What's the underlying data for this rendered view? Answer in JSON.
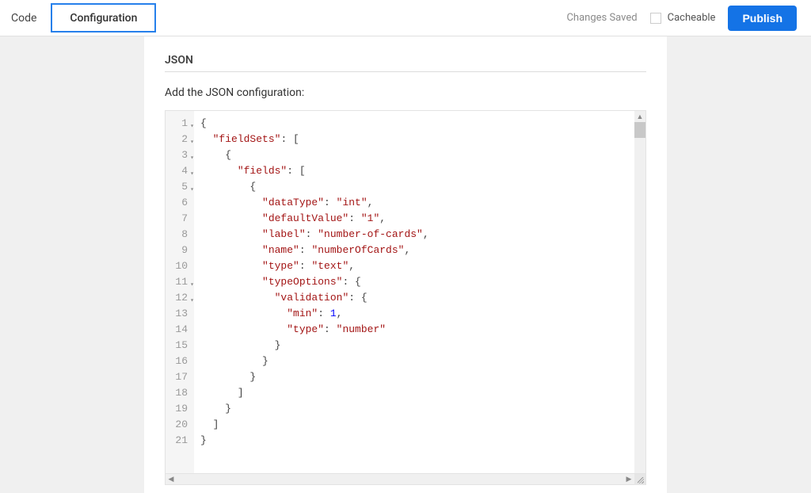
{
  "header": {
    "tabs": [
      {
        "id": "code",
        "label": "Code",
        "active": false
      },
      {
        "id": "configuration",
        "label": "Configuration",
        "active": true
      }
    ],
    "status": "Changes Saved",
    "cacheable_label": "Cacheable",
    "cacheable_checked": false,
    "publish_label": "Publish"
  },
  "panel": {
    "section_title": "JSON",
    "hint": "Add the JSON configuration:"
  },
  "editor": {
    "line_count": 21,
    "lines": [
      {
        "n": 1,
        "fold": true,
        "tokens": [
          [
            "p",
            "{"
          ]
        ]
      },
      {
        "n": 2,
        "fold": true,
        "tokens": [
          [
            "ws",
            "  "
          ],
          [
            "key",
            "\"fieldSets\""
          ],
          [
            "p",
            ": ["
          ]
        ]
      },
      {
        "n": 3,
        "fold": true,
        "tokens": [
          [
            "ws",
            "    "
          ],
          [
            "p",
            "{"
          ]
        ]
      },
      {
        "n": 4,
        "fold": true,
        "tokens": [
          [
            "ws",
            "      "
          ],
          [
            "key",
            "\"fields\""
          ],
          [
            "p",
            ": ["
          ]
        ]
      },
      {
        "n": 5,
        "fold": true,
        "tokens": [
          [
            "ws",
            "        "
          ],
          [
            "p",
            "{"
          ]
        ]
      },
      {
        "n": 6,
        "fold": false,
        "tokens": [
          [
            "ws",
            "          "
          ],
          [
            "key",
            "\"dataType\""
          ],
          [
            "p",
            ": "
          ],
          [
            "str",
            "\"int\""
          ],
          [
            "p",
            ","
          ]
        ]
      },
      {
        "n": 7,
        "fold": false,
        "tokens": [
          [
            "ws",
            "          "
          ],
          [
            "key",
            "\"defaultValue\""
          ],
          [
            "p",
            ": "
          ],
          [
            "str",
            "\"1\""
          ],
          [
            "p",
            ","
          ]
        ]
      },
      {
        "n": 8,
        "fold": false,
        "tokens": [
          [
            "ws",
            "          "
          ],
          [
            "key",
            "\"label\""
          ],
          [
            "p",
            ": "
          ],
          [
            "str",
            "\"number-of-cards\""
          ],
          [
            "p",
            ","
          ]
        ]
      },
      {
        "n": 9,
        "fold": false,
        "tokens": [
          [
            "ws",
            "          "
          ],
          [
            "key",
            "\"name\""
          ],
          [
            "p",
            ": "
          ],
          [
            "str",
            "\"numberOfCards\""
          ],
          [
            "p",
            ","
          ]
        ]
      },
      {
        "n": 10,
        "fold": false,
        "tokens": [
          [
            "ws",
            "          "
          ],
          [
            "key",
            "\"type\""
          ],
          [
            "p",
            ": "
          ],
          [
            "str",
            "\"text\""
          ],
          [
            "p",
            ","
          ]
        ]
      },
      {
        "n": 11,
        "fold": true,
        "tokens": [
          [
            "ws",
            "          "
          ],
          [
            "key",
            "\"typeOptions\""
          ],
          [
            "p",
            ": {"
          ]
        ]
      },
      {
        "n": 12,
        "fold": true,
        "tokens": [
          [
            "ws",
            "            "
          ],
          [
            "key",
            "\"validation\""
          ],
          [
            "p",
            ": {"
          ]
        ]
      },
      {
        "n": 13,
        "fold": false,
        "tokens": [
          [
            "ws",
            "              "
          ],
          [
            "key",
            "\"min\""
          ],
          [
            "p",
            ": "
          ],
          [
            "num",
            "1"
          ],
          [
            "p",
            ","
          ]
        ]
      },
      {
        "n": 14,
        "fold": false,
        "tokens": [
          [
            "ws",
            "              "
          ],
          [
            "key",
            "\"type\""
          ],
          [
            "p",
            ": "
          ],
          [
            "str",
            "\"number\""
          ]
        ]
      },
      {
        "n": 15,
        "fold": false,
        "tokens": [
          [
            "ws",
            "            "
          ],
          [
            "p",
            "}"
          ]
        ]
      },
      {
        "n": 16,
        "fold": false,
        "tokens": [
          [
            "ws",
            "          "
          ],
          [
            "p",
            "}"
          ]
        ]
      },
      {
        "n": 17,
        "fold": false,
        "tokens": [
          [
            "ws",
            "        "
          ],
          [
            "p",
            "}"
          ]
        ]
      },
      {
        "n": 18,
        "fold": false,
        "tokens": [
          [
            "ws",
            "      "
          ],
          [
            "p",
            "]"
          ]
        ]
      },
      {
        "n": 19,
        "fold": false,
        "tokens": [
          [
            "ws",
            "    "
          ],
          [
            "p",
            "}"
          ]
        ]
      },
      {
        "n": 20,
        "fold": false,
        "tokens": [
          [
            "ws",
            "  "
          ],
          [
            "p",
            "]"
          ]
        ]
      },
      {
        "n": 21,
        "fold": false,
        "tokens": [
          [
            "p",
            "}"
          ]
        ]
      }
    ],
    "raw_json": "{\n  \"fieldSets\": [\n    {\n      \"fields\": [\n        {\n          \"dataType\": \"int\",\n          \"defaultValue\": \"1\",\n          \"label\": \"number-of-cards\",\n          \"name\": \"numberOfCards\",\n          \"type\": \"text\",\n          \"typeOptions\": {\n            \"validation\": {\n              \"min\": 1,\n              \"type\": \"number\"\n            }\n          }\n        }\n      ]\n    }\n  ]\n}"
  }
}
